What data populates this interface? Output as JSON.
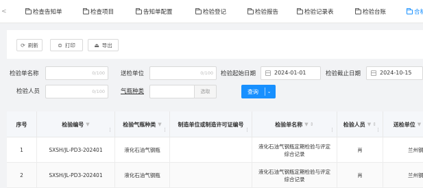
{
  "nav": {
    "prev_glyph": "<",
    "tabs": [
      {
        "label": "检查告知单",
        "active": false
      },
      {
        "label": "检查项目",
        "active": false
      },
      {
        "label": "告知单配置",
        "active": false
      },
      {
        "label": "检验登记",
        "active": false
      },
      {
        "label": "检验报告",
        "active": false
      },
      {
        "label": "检验记录表",
        "active": false
      },
      {
        "label": "检验台账",
        "active": false
      },
      {
        "label": "合格",
        "active": true
      }
    ]
  },
  "toolbar": {
    "refresh_label": "刷新",
    "print_label": "打印",
    "export_label": "导出",
    "refresh_icon": "refresh-icon",
    "print_icon": "print-icon",
    "export_icon": "export-icon"
  },
  "filters": {
    "unit_name_label": "检验单名称",
    "unit_name_count": "0/100",
    "send_unit_label": "送检单位",
    "send_unit_count": "0/100",
    "start_date_label": "检验起始日期",
    "start_date_value": "2024-01-01",
    "end_date_label": "检验截止日期",
    "end_date_value": "2024-10-15",
    "inspector_label": "检验人员",
    "inspector_count": "0/100",
    "cylinder_type_label": "气瓶种类",
    "select_placeholder": "选取",
    "query_label": "查询",
    "query_chevron": "⌄"
  },
  "table": {
    "columns": [
      "序号",
      "检验编号",
      "检验气瓶种类",
      "制造单位或制造许可证编号",
      "检验单名称",
      "检验人员",
      "送检单位"
    ],
    "rows": [
      {
        "index": "1",
        "code": "SXSH/JL-PD3-202401",
        "type": "液化石油气钢瓶",
        "maker": "",
        "name": "液化石油气钢瓶定期检验与评定综合记录",
        "inspector": "肖",
        "unit": "兰州钢瓶"
      },
      {
        "index": "2",
        "code": "SXSH/JL-PD3-202401",
        "type": "液化石油气钢瓶",
        "maker": "",
        "name": "液化石油气钢瓶定期检验与评定综合记录",
        "inspector": "肖",
        "unit": "兰州钢瓶"
      }
    ]
  },
  "colors": {
    "accent": "#1890ff",
    "background": "#f2f3f5"
  }
}
